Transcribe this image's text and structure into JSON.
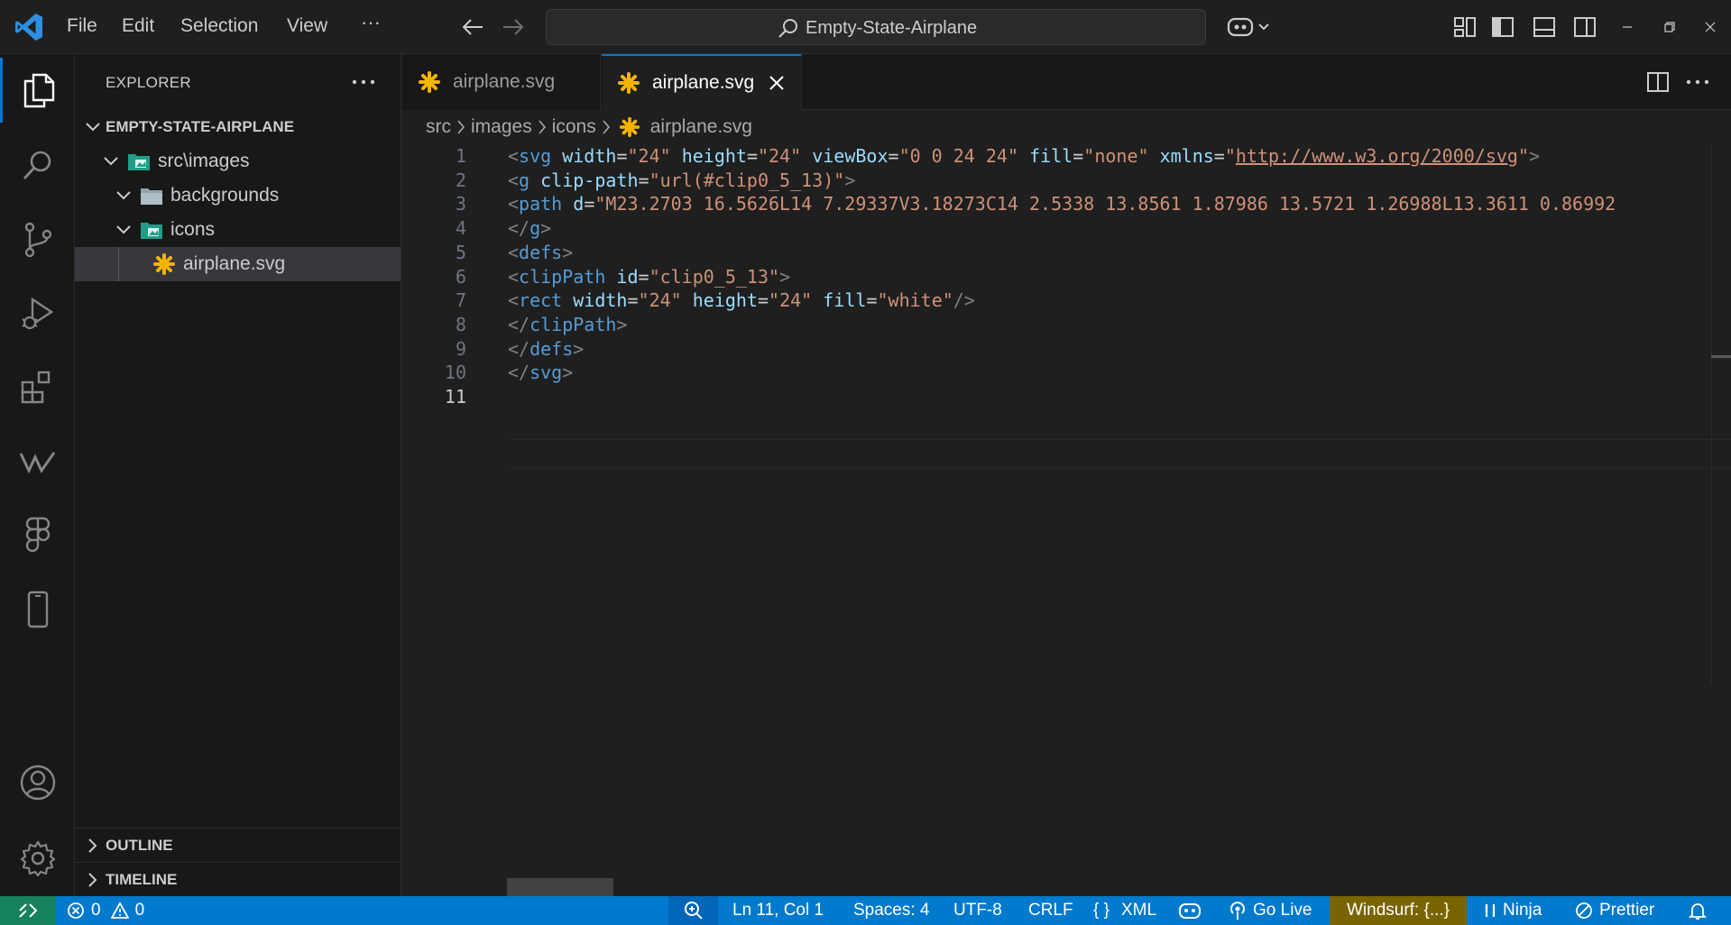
{
  "titlebar": {
    "menu": [
      "File",
      "Edit",
      "Selection",
      "View"
    ],
    "more": "···",
    "search_text": "Empty-State-Airplane"
  },
  "sidebar": {
    "title": "EXPLORER",
    "project": "EMPTY-STATE-AIRPLANE",
    "tree": [
      {
        "label": "src\\images"
      },
      {
        "label": "backgrounds"
      },
      {
        "label": "icons"
      },
      {
        "label": "airplane.svg"
      }
    ],
    "outline": "OUTLINE",
    "timeline": "TIMELINE"
  },
  "tabs": [
    {
      "label": "airplane.svg"
    },
    {
      "label": "airplane.svg"
    }
  ],
  "breadcrumb": [
    "src",
    "images",
    "icons",
    "airplane.svg"
  ],
  "editor": {
    "lines": [
      {
        "n": "1",
        "tokens": [
          [
            "p",
            "<"
          ],
          [
            "t",
            "svg"
          ],
          [
            "w",
            " "
          ],
          [
            "a",
            "width"
          ],
          [
            "e",
            "="
          ],
          [
            "s",
            "\"24\""
          ],
          [
            "w",
            " "
          ],
          [
            "a",
            "height"
          ],
          [
            "e",
            "="
          ],
          [
            "s",
            "\"24\""
          ],
          [
            "w",
            " "
          ],
          [
            "a",
            "viewBox"
          ],
          [
            "e",
            "="
          ],
          [
            "s",
            "\"0 0 24 24\""
          ],
          [
            "w",
            " "
          ],
          [
            "a",
            "fill"
          ],
          [
            "e",
            "="
          ],
          [
            "s",
            "\"none\""
          ],
          [
            "w",
            " "
          ],
          [
            "a",
            "xmlns"
          ],
          [
            "e",
            "="
          ],
          [
            "s",
            "\""
          ],
          [
            "l",
            "http://www.w3.org/2000/svg"
          ],
          [
            "s",
            "\""
          ],
          [
            "p",
            ">"
          ]
        ]
      },
      {
        "n": "2",
        "tokens": [
          [
            "p",
            "<"
          ],
          [
            "t",
            "g"
          ],
          [
            "w",
            " "
          ],
          [
            "a",
            "clip-path"
          ],
          [
            "e",
            "="
          ],
          [
            "s",
            "\"url(#clip0_5_13)\""
          ],
          [
            "p",
            ">"
          ]
        ]
      },
      {
        "n": "3",
        "tokens": [
          [
            "p",
            "<"
          ],
          [
            "t",
            "path"
          ],
          [
            "w",
            " "
          ],
          [
            "a",
            "d"
          ],
          [
            "e",
            "="
          ],
          [
            "s",
            "\"M23.2703 16.5626L14 7.29337V3.18273C14 2.5338 13.8561 1.87986 13.5721 1.26988L13.3611 0.86992"
          ]
        ]
      },
      {
        "n": "4",
        "tokens": [
          [
            "p",
            "</"
          ],
          [
            "t",
            "g"
          ],
          [
            "p",
            ">"
          ]
        ]
      },
      {
        "n": "5",
        "tokens": [
          [
            "p",
            "<"
          ],
          [
            "t",
            "defs"
          ],
          [
            "p",
            ">"
          ]
        ]
      },
      {
        "n": "6",
        "tokens": [
          [
            "p",
            "<"
          ],
          [
            "t",
            "clipPath"
          ],
          [
            "w",
            " "
          ],
          [
            "a",
            "id"
          ],
          [
            "e",
            "="
          ],
          [
            "s",
            "\"clip0_5_13\""
          ],
          [
            "p",
            ">"
          ]
        ]
      },
      {
        "n": "7",
        "tokens": [
          [
            "p",
            "<"
          ],
          [
            "t",
            "rect"
          ],
          [
            "w",
            " "
          ],
          [
            "a",
            "width"
          ],
          [
            "e",
            "="
          ],
          [
            "s",
            "\"24\""
          ],
          [
            "w",
            " "
          ],
          [
            "a",
            "height"
          ],
          [
            "e",
            "="
          ],
          [
            "s",
            "\"24\""
          ],
          [
            "w",
            " "
          ],
          [
            "a",
            "fill"
          ],
          [
            "e",
            "="
          ],
          [
            "s",
            "\"white\""
          ],
          [
            "p",
            "/>"
          ]
        ]
      },
      {
        "n": "8",
        "tokens": [
          [
            "p",
            "</"
          ],
          [
            "t",
            "clipPath"
          ],
          [
            "p",
            ">"
          ]
        ]
      },
      {
        "n": "9",
        "tokens": [
          [
            "p",
            "</"
          ],
          [
            "t",
            "defs"
          ],
          [
            "p",
            ">"
          ]
        ]
      },
      {
        "n": "10",
        "tokens": [
          [
            "p",
            "</"
          ],
          [
            "t",
            "svg"
          ],
          [
            "p",
            ">"
          ]
        ]
      },
      {
        "n": "11",
        "tokens": []
      }
    ],
    "current_line": "11"
  },
  "statusbar": {
    "errors": "0",
    "warnings": "0",
    "position": "Ln 11, Col 1",
    "spaces": "Spaces: 4",
    "encoding": "UTF-8",
    "eol": "CRLF",
    "language_icon": "{ }",
    "language": "XML",
    "golive": "Go Live",
    "windsurf": "Windsurf: {...}",
    "ninja": "Ninja",
    "prettier": "Prettier"
  },
  "colors": {
    "accent": "#0078d4",
    "statusbar": "#007acc",
    "remote": "#16825d",
    "windsurf_bg": "#7a6400",
    "svg_file_icon": "#f5b400"
  }
}
